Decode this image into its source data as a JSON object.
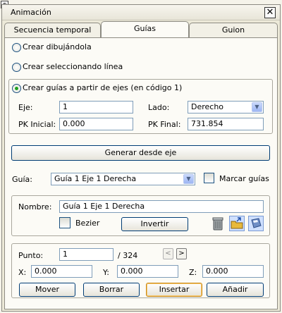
{
  "window": {
    "title": "Animación"
  },
  "tabs": [
    {
      "label": "Secuencia temporal",
      "active": false
    },
    {
      "label": "Guías",
      "active": true
    },
    {
      "label": "Guion",
      "active": false
    }
  ],
  "mode": {
    "draw_label": "Crear dibujándola",
    "select_line_label": "Crear seleccionando línea",
    "from_axis_label": "Crear guías a partir de ejes (en código 1)",
    "selected": "from_axis"
  },
  "axis_params": {
    "eje_label": "Eje:",
    "eje_value": "1",
    "lado_label": "Lado:",
    "lado_value": "Derecho",
    "pk_inicial_label": "PK Inicial:",
    "pk_inicial_value": "0.000",
    "pk_final_label": "PK Final:",
    "pk_final_value": "731.854"
  },
  "generate_button": "Generar desde eje",
  "guide": {
    "label": "Guía:",
    "value": "Guía 1 Eje 1 Derecha",
    "mark_label": "Marcar guías",
    "mark_checked": false
  },
  "guide_props": {
    "name_label": "Nombre:",
    "name_value": "Guía 1 Eje 1 Derecha",
    "bezier_label": "Bezier",
    "bezier_checked": false,
    "invert_button": "Invertir"
  },
  "points": {
    "punto_label": "Punto:",
    "punto_value": "1",
    "total": "/ 324",
    "prev": "<",
    "next": ">",
    "x_label": "X:",
    "x_value": "0.000",
    "y_label": "Y:",
    "y_value": "0.000",
    "z_label": "Z:",
    "z_value": "0.000",
    "buttons": {
      "move": "Mover",
      "delete": "Borrar",
      "insert": "Insertar",
      "add": "Añadir"
    }
  },
  "colors": {
    "accent_green": "#21a121",
    "radio_border": "#1c5180",
    "input_border": "#7f9db9",
    "default_button_border": "#c88a1c"
  }
}
